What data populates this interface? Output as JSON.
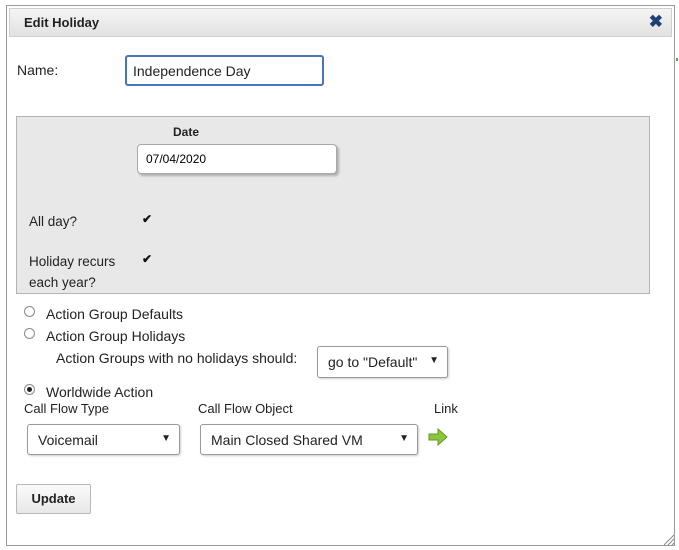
{
  "dialog": {
    "title": "Edit Holiday",
    "close_icon": "close-icon"
  },
  "name": {
    "label": "Name:",
    "value": "Independence Day"
  },
  "date_section": {
    "label": "Date",
    "value": "07/04/2020",
    "all_day_label": "All day?",
    "all_day_checked": true,
    "recurs_label_line1": "Holiday recurs",
    "recurs_label_line2": "each year?",
    "recurs_checked": true
  },
  "actions": {
    "defaults_label": "Action Group Defaults",
    "defaults_checked": false,
    "holidays_label": "Action Group Holidays",
    "holidays_checked": false,
    "no_holidays_hint": "Action Groups with no holidays should:",
    "no_holidays_select": "go to \"Default\"",
    "worldwide_label": "Worldwide Action",
    "worldwide_checked": true
  },
  "call_flow": {
    "type_header": "Call Flow Type",
    "object_header": "Call Flow Object",
    "link_header": "Link",
    "type_value": "Voicemail",
    "object_value": "Main Closed Shared VM",
    "link_icon": "green-arrow-right-icon"
  },
  "buttons": {
    "update_label": "Update"
  },
  "colors": {
    "accent_border": "#4a72bd",
    "close_icon": "#1e3f77",
    "link_arrow": "#8cc63f",
    "panel_bg": "#e8e8e8"
  }
}
